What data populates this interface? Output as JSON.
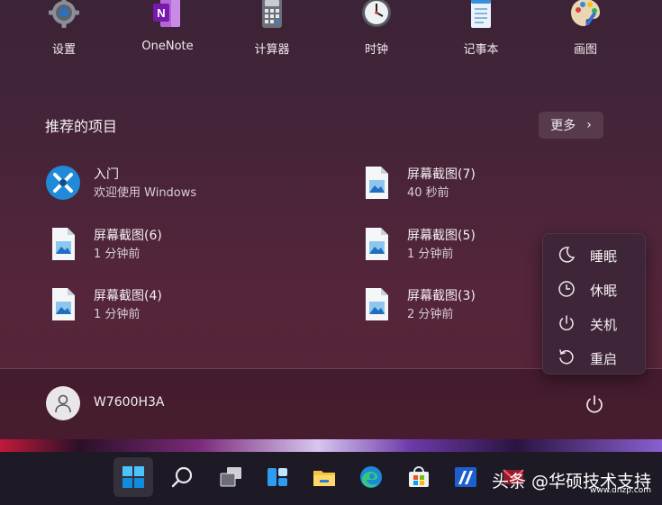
{
  "pinned_apps": [
    {
      "label": "设置",
      "icon": "gear-icon"
    },
    {
      "label": "OneNote",
      "icon": "onenote-icon"
    },
    {
      "label": "计算器",
      "icon": "calculator-icon"
    },
    {
      "label": "时钟",
      "icon": "clock-icon"
    },
    {
      "label": "记事本",
      "icon": "notepad-icon"
    },
    {
      "label": "画图",
      "icon": "paint-icon"
    }
  ],
  "recommended": {
    "title": "推荐的项目",
    "more_label": "更多",
    "items": [
      {
        "name": "入门",
        "sub": "欢迎使用 Windows",
        "icon": "get-started-icon"
      },
      {
        "name": "屏幕截图(7)",
        "sub": "40 秒前",
        "icon": "image-file-icon"
      },
      {
        "name": "屏幕截图(6)",
        "sub": "1 分钟前",
        "icon": "image-file-icon"
      },
      {
        "name": "屏幕截图(5)",
        "sub": "1 分钟前",
        "icon": "image-file-icon"
      },
      {
        "name": "屏幕截图(4)",
        "sub": "1 分钟前",
        "icon": "image-file-icon"
      },
      {
        "name": "屏幕截图(3)",
        "sub": "2 分钟前",
        "icon": "image-file-icon"
      }
    ]
  },
  "power_menu": {
    "items": [
      {
        "label": "睡眠",
        "icon": "moon-icon"
      },
      {
        "label": "休眠",
        "icon": "clock-outline-icon"
      },
      {
        "label": "关机",
        "icon": "power-icon"
      },
      {
        "label": "重启",
        "icon": "restart-icon"
      }
    ]
  },
  "user": {
    "name": "W7600H3A"
  },
  "taskbar": {
    "items": [
      "windows-start-icon",
      "search-icon",
      "task-view-icon",
      "widgets-icon",
      "file-explorer-icon",
      "edge-icon",
      "store-icon",
      "app-icon",
      "mail-icon"
    ]
  },
  "watermark": {
    "text": "头条 @华硕技术支持",
    "url": "www.dnzp.com"
  },
  "colors": {
    "accent": "#0078d4",
    "menu_bg": "#4a2439",
    "taskbar_bg": "#1d1a26"
  }
}
